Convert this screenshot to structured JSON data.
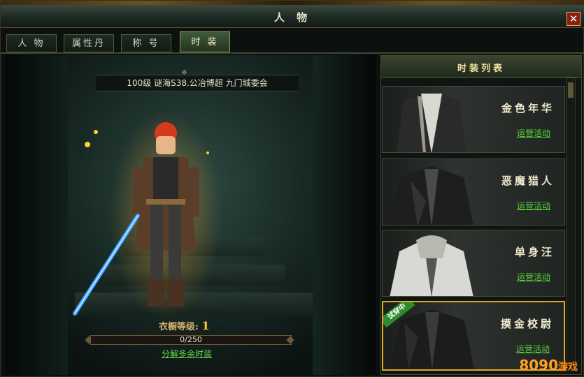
{
  "window": {
    "title": "人 物"
  },
  "tabs": [
    {
      "label": "人 物",
      "active": false
    },
    {
      "label": "属性丹",
      "active": false
    },
    {
      "label": "称 号",
      "active": false
    },
    {
      "label": "时 装",
      "active": true
    }
  ],
  "character": {
    "info": "100级   谜海S38.公冶博超   九门城委会",
    "wardrobe_label": "衣橱等级:",
    "wardrobe_level": "1",
    "progress_text": "0/250",
    "progress": 0,
    "decompose_link": "分解多余时装"
  },
  "panel": {
    "title": "时装列表",
    "items": [
      {
        "name": "金色年华",
        "link": "运营活动",
        "selected": false,
        "badge": ""
      },
      {
        "name": "恶魔猎人",
        "link": "运营活动",
        "selected": false,
        "badge": ""
      },
      {
        "name": "单身汪",
        "link": "运营活动",
        "selected": false,
        "badge": ""
      },
      {
        "name": "摸金校尉",
        "link": "运营活动",
        "selected": true,
        "badge": "试穿中"
      }
    ]
  },
  "watermark": {
    "brand": "8090",
    "suffix": "游戏"
  },
  "colors": {
    "accent": "#e0a820",
    "link": "#5ad23a",
    "title": "#e8e2c8"
  }
}
